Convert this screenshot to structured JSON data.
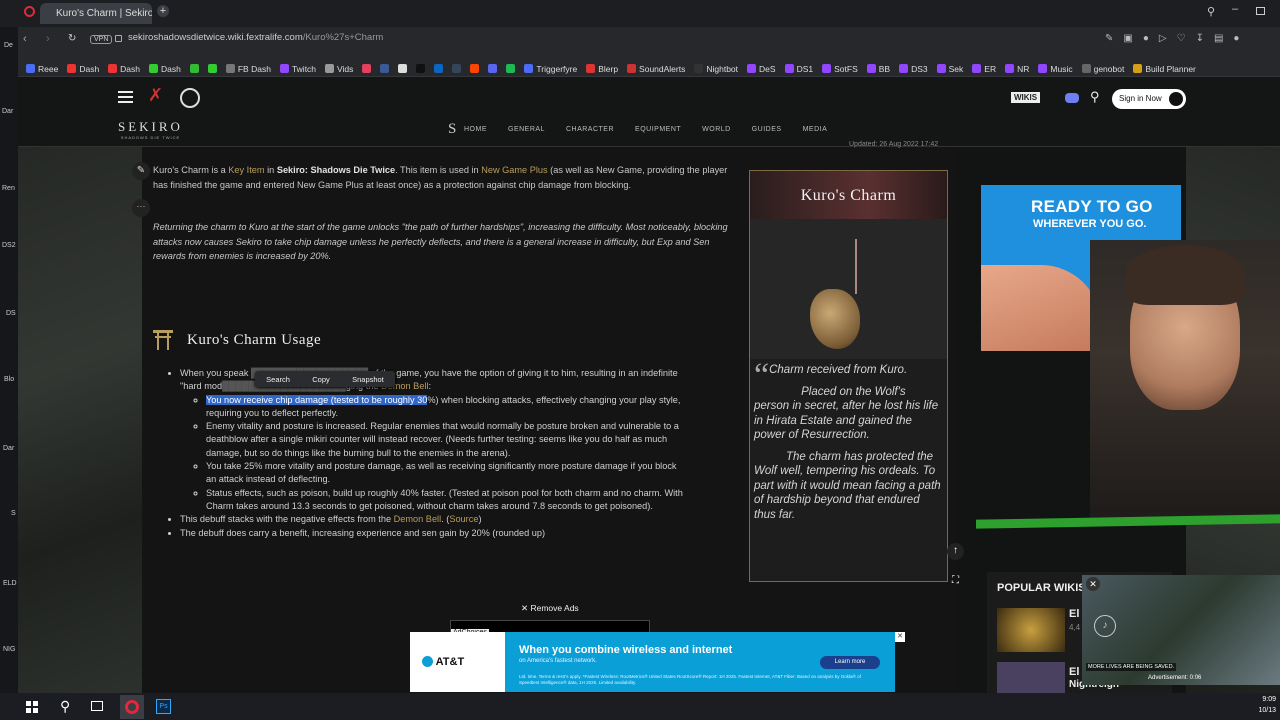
{
  "browser": {
    "tab_title": "Kuro's Charm | Sekiro Sha",
    "url_host": "sekiroshadowsdietwice.wiki.fextralife.com",
    "url_path": "/Kuro%27s+Charm",
    "vpn_label": "VPN",
    "bookmarks": [
      {
        "label": "Reee",
        "color": "#4a6cf7"
      },
      {
        "label": "Dash",
        "color": "#e33"
      },
      {
        "label": "Dash",
        "color": "#e33"
      },
      {
        "label": "Dash",
        "color": "#3c3"
      },
      {
        "label": "",
        "color": "#3b3"
      },
      {
        "label": "",
        "color": "#3c3"
      },
      {
        "label": "FB Dash",
        "color": "#777"
      },
      {
        "label": "Twitch",
        "color": "#9146ff"
      },
      {
        "label": "Vids",
        "color": "#999"
      },
      {
        "label": "",
        "color": "#e4405f"
      },
      {
        "label": "",
        "color": "#3b5998"
      },
      {
        "label": "",
        "color": "#ddd"
      },
      {
        "label": "",
        "color": "#111"
      },
      {
        "label": "",
        "color": "#0a66c2"
      },
      {
        "label": "",
        "color": "#35465c"
      },
      {
        "label": "",
        "color": "#ff4500"
      },
      {
        "label": "",
        "color": "#5865f2"
      },
      {
        "label": "",
        "color": "#1db954"
      },
      {
        "label": "Triggerfyre",
        "color": "#4a6cf7"
      },
      {
        "label": "Blerp",
        "color": "#d33"
      },
      {
        "label": "SoundAlerts",
        "color": "#c33"
      },
      {
        "label": "Nightbot",
        "color": "#333"
      },
      {
        "label": "DeS",
        "color": "#9146ff"
      },
      {
        "label": "DS1",
        "color": "#9146ff"
      },
      {
        "label": "SotFS",
        "color": "#9146ff"
      },
      {
        "label": "BB",
        "color": "#9146ff"
      },
      {
        "label": "DS3",
        "color": "#9146ff"
      },
      {
        "label": "Sek",
        "color": "#9146ff"
      },
      {
        "label": "ER",
        "color": "#9146ff"
      },
      {
        "label": "NR",
        "color": "#9146ff"
      },
      {
        "label": "Music",
        "color": "#9146ff"
      },
      {
        "label": "genobot",
        "color": "#666"
      },
      {
        "label": "Build Planner",
        "color": "#d4a017"
      }
    ]
  },
  "site": {
    "logo": "SEKIRO",
    "logo_sub": "SHADOWS DIE TWICE",
    "nav": [
      "Home",
      "General",
      "Character",
      "Equipment",
      "World",
      "Guides",
      "Media"
    ],
    "wikis_label": "WIKIS",
    "sign_in": "Sign in Now"
  },
  "article": {
    "updated": "Updated: 26 Aug 2022 17:42",
    "intro_1": "Kuro's Charm is a ",
    "intro_link_1": "Key Item",
    "intro_2": " in ",
    "intro_bold": "Sekiro: Shadows Die Twice",
    "intro_3": ". This item is used in ",
    "intro_link_2": "New Game Plus",
    "intro_4": " (as well as New Game, providing the player has finished the game and entered New Game Plus at least once) as a protection against chip damage from blocking.",
    "italic_para": "Returning the charm to Kuro at the start of the game unlocks \"the path of further hardships\", increasing the difficulty. Most noticeably, blocking attacks now causes Sekiro to take chip damage unless he perfectly deflects, and there is a general increase in difficulty, but Exp and Sen rewards from enemies is increased by 20%.",
    "section_title": "Kuro's Charm Usage",
    "bullet_1a": "When you speak ",
    "bullet_1b": " of the game, you have the option of giving it to him, resulting in an indefinite \"hard mod",
    "bullet_1c": "ging the ",
    "bullet_1_link": "Demon Bell",
    "sub_1_hl": "You now receive chip damage (tested to be roughly 30",
    "sub_1_rest": "%) when blocking attacks, effectively changing your play style, requiring you to deflect perfectly.",
    "sub_2": "Enemy vitality and posture is increased. Regular enemies that would normally be posture broken and vulnerable to a deathblow after a single mikiri counter will instead recover. (Needs further testing: seems like you do half as much damage, but so do things like the burning bull to the enemies in the arena).",
    "sub_3": "You take 25% more vitality and posture damage, as well as receiving significantly more posture damage if you block an attack instead of deflecting.",
    "sub_4": "Status effects, such as poison, build up roughly 40% faster. (Tested at poison pool for both charm and no charm. With Charm takes around 13.3 seconds to get poisoned, without charm takes around 7.8 seconds to get poisoned).",
    "bullet_2a": "This debuff stacks with the negative effects from the ",
    "bullet_2_link": "Demon Bell",
    "bullet_2_src": "Source",
    "bullet_3": "The debuff does carry a benefit, increasing experience and sen gain by 20% (rounded up)",
    "context_menu": [
      "Search",
      "Copy",
      "Snapshot"
    ]
  },
  "infobox": {
    "title": "Kuro's Charm",
    "quote_1": "Charm received from Kuro.",
    "quote_2": "Placed on the Wolf's person in secret, after he lost his life in Hirata Estate and gained the power of Resurrection.",
    "quote_3": "The charm has protected the Wolf well, tempering his ordeals. To part with it would mean facing a path of hardship beyond that endured thus far."
  },
  "ads": {
    "remove_ads": "Remove Ads",
    "adchoices": "AdChoices",
    "right_ad_line1": "READY TO GO",
    "right_ad_line2": "WHEREVER YOU GO.",
    "att_brand": "AT&T",
    "att_headline": "When you combine wireless and internet",
    "att_sub": "on America's fastest network.",
    "att_cta": "Learn more",
    "att_fine": "Ltd. time. Terms & restr's apply. *Fastest Wireless: RootMetrics® United States RootScore® Report: 1H 2025. Fastest Internet, AT&T Fiber: Based on analysis by Ookla® of Speedtest Intelligence® data, 1H 2025. Limited availability.",
    "video_caption": "MORE LIVES ARE BEING SAVED.",
    "video_ad_label": "Advertisement: 0:06"
  },
  "popular": {
    "title": "POPULAR WIKIS",
    "items": [
      "El",
      "4,4",
      "El",
      "Nightreign"
    ]
  },
  "taskbar": {
    "time": "9:09",
    "date": "10/13"
  },
  "desktop_labels": [
    "De",
    "Dar",
    "Ren",
    "DS2",
    "DS",
    "Blo",
    "Dar",
    "S",
    "ELD",
    "NIG"
  ],
  "colors": {
    "link": "#b99d5c",
    "highlight": "#2f67c8",
    "infobox_border": "#7b6a43"
  }
}
